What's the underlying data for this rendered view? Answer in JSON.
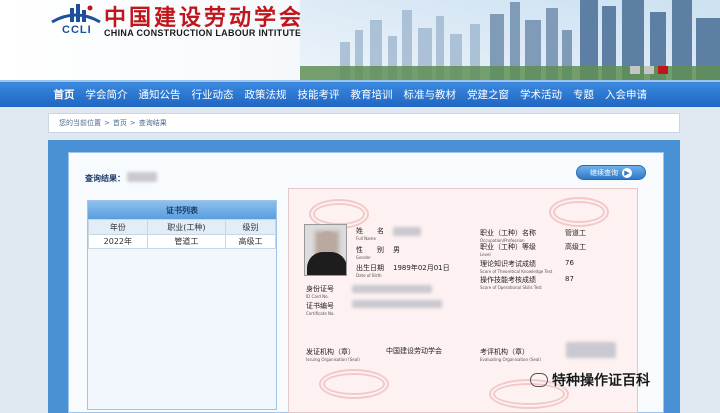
{
  "header": {
    "logo_text": "CCLI",
    "title_cn": "中国建设劳动学会",
    "title_en": "CHINA CONSTRUCTION LABOUR INTITUTE",
    "colors": {
      "title": "#c0161b",
      "nav": "#2a72cf"
    }
  },
  "nav": {
    "items": [
      {
        "label": "首页"
      },
      {
        "label": "学会简介"
      },
      {
        "label": "通知公告"
      },
      {
        "label": "行业动态"
      },
      {
        "label": "政策法规"
      },
      {
        "label": "技能考评"
      },
      {
        "label": "教育培训"
      },
      {
        "label": "标准与教材"
      },
      {
        "label": "党建之窗"
      },
      {
        "label": "学术活动"
      },
      {
        "label": "专题"
      },
      {
        "label": "入会申请"
      }
    ]
  },
  "breadcrumb": {
    "prefix": "您的当前位置",
    "home": "首页",
    "sep": ">",
    "current": "查询结果"
  },
  "result": {
    "label": "查询结果：",
    "continue_button": "继续查询"
  },
  "cert_list": {
    "title": "证书列表",
    "columns": [
      "年份",
      "职业(工种)",
      "级别"
    ],
    "rows": [
      {
        "year": "2022年",
        "occupation": "管道工",
        "level": "高级工"
      }
    ]
  },
  "certificate": {
    "name_label": "姓　　名",
    "name_label_en": "Full Name",
    "gender_label": "性　　别",
    "gender_label_en": "Gender",
    "gender_value": "男",
    "dob_label": "出生日期",
    "dob_label_en": "Date of Birth",
    "dob_value": "1989年02月01日",
    "id_label": "身份证号",
    "id_label_en": "ID Card No.",
    "cert_no_label": "证书编号",
    "cert_no_label_en": "Certificate No.",
    "occupation_label": "职业（工种）名称",
    "occupation_label_en": "Occupation/Profession",
    "occupation_value": "管道工",
    "level_label": "职业（工种）等级",
    "level_label_en": "Level",
    "level_value": "高级工",
    "theory_label": "理论知识考试成绩",
    "theory_label_en": "Score of Theoretical Knowledge Test",
    "theory_value": "76",
    "skill_label": "操作技能考核成绩",
    "skill_label_en": "Score of Operational Skills Test",
    "skill_value": "87",
    "issuer_label": "发证机构（章）",
    "issuer_label_en": "Issuing Organisation (Seal)",
    "issuer_value": "中国建设劳动学会",
    "evaluator_label": "考评机构（章）",
    "evaluator_label_en": "Evaluating Organisation (Seal)"
  },
  "watermark": {
    "brand": "特种操作证百科"
  }
}
